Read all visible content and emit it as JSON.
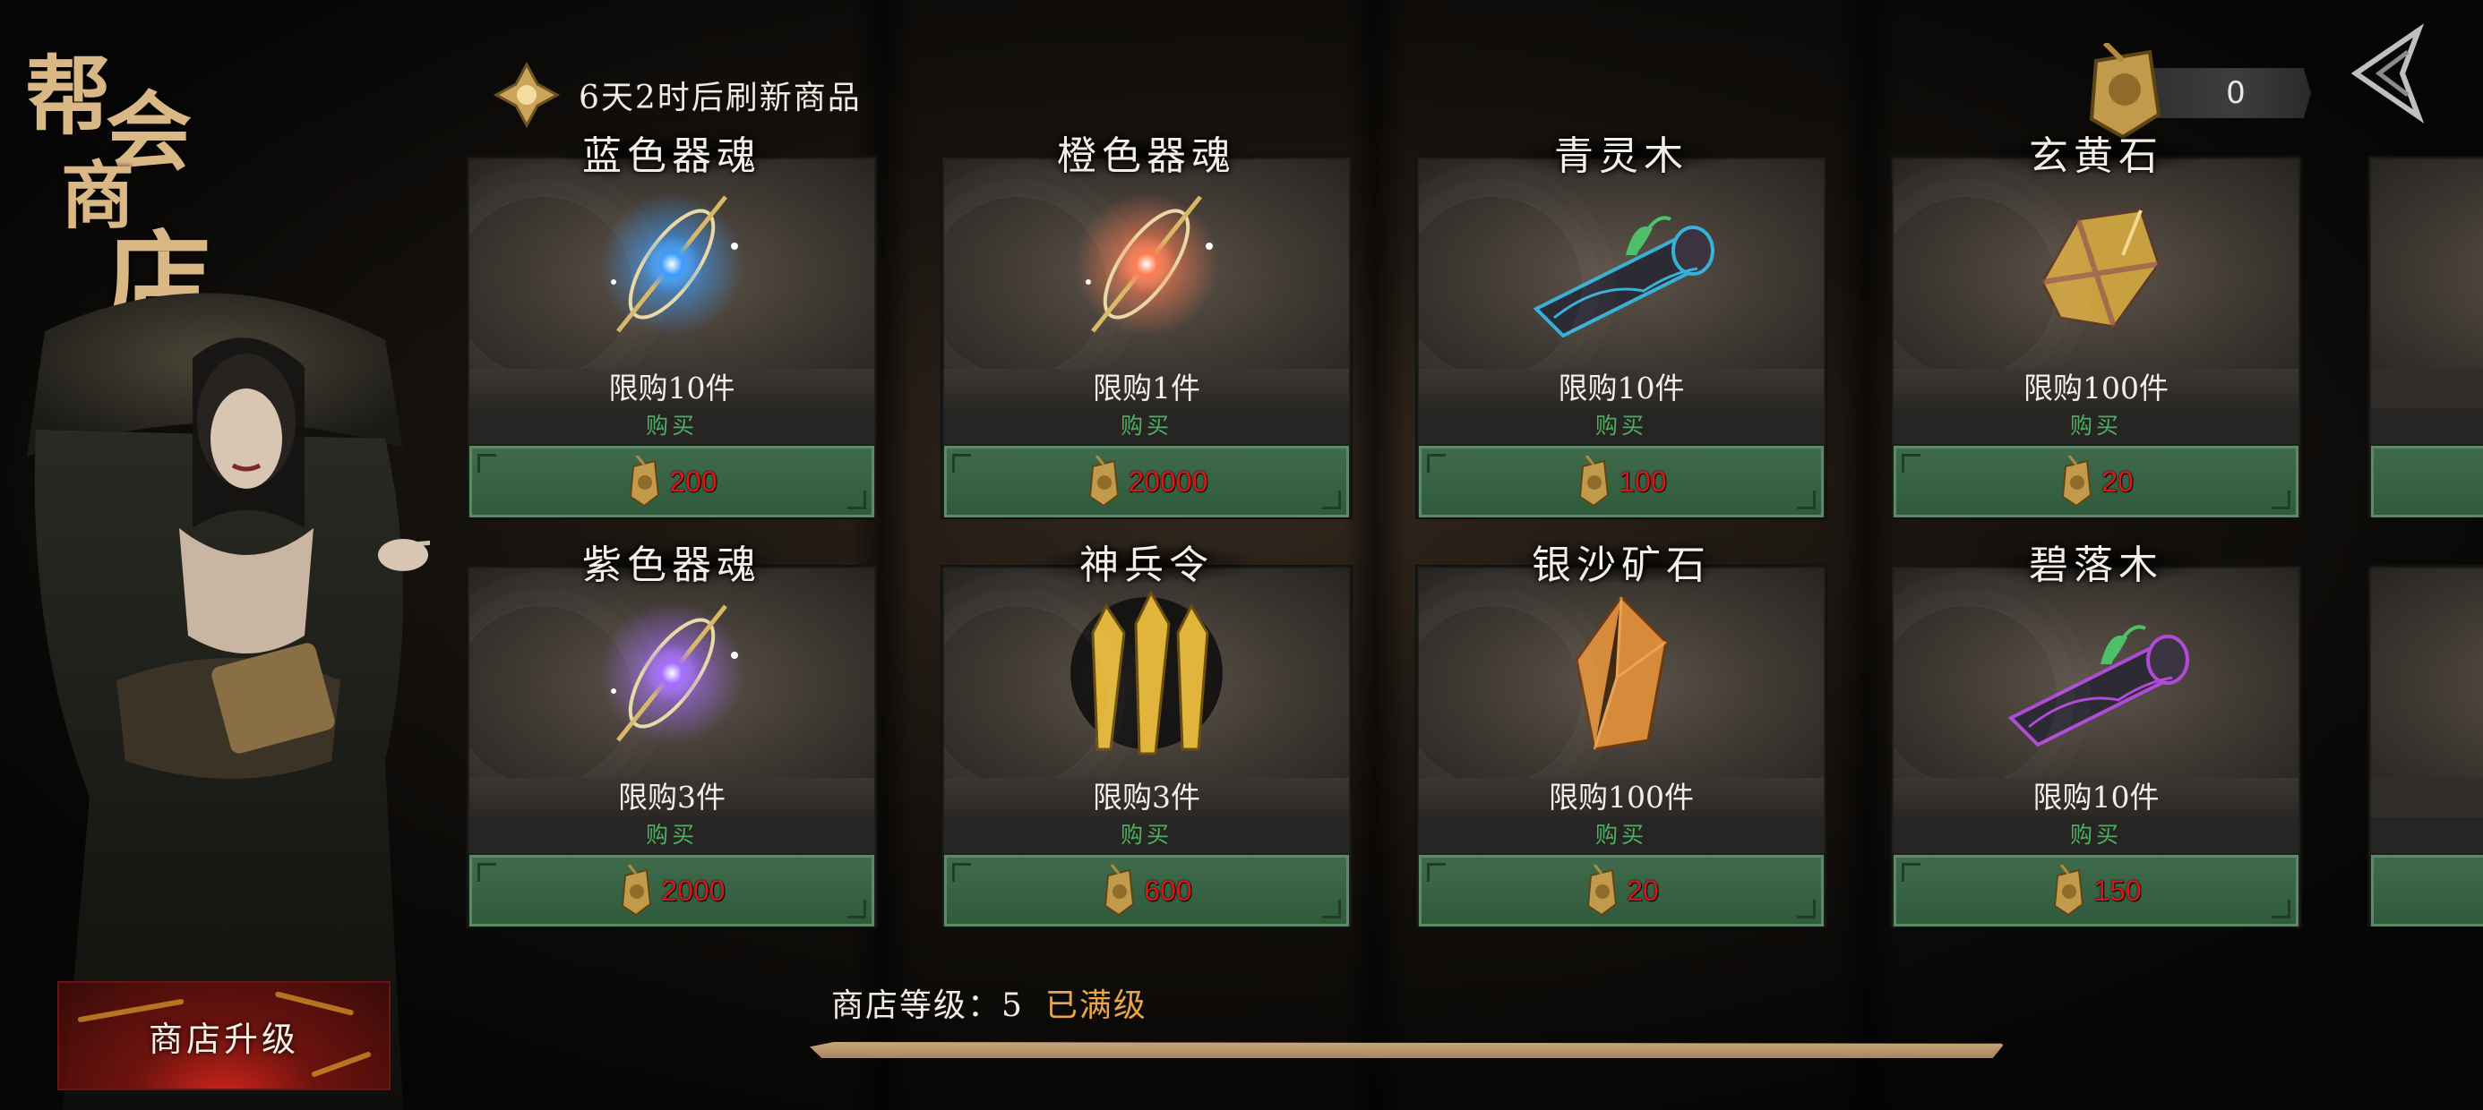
{
  "shop": {
    "title_chars": [
      "帮",
      "会",
      "商",
      "店"
    ]
  },
  "header": {
    "refresh_text": "6天2时后刷新商品",
    "currency_amount": "0"
  },
  "items": [
    {
      "name": "蓝色器魂",
      "limit": "限购10件",
      "buy_label": "购买",
      "price": "200",
      "icon": "blue-orb-icon",
      "color": "#3a9cff"
    },
    {
      "name": "橙色器魂",
      "limit": "限购1件",
      "buy_label": "购买",
      "price": "20000",
      "icon": "orange-orb-icon",
      "color": "#ff7a50"
    },
    {
      "name": "青灵木",
      "limit": "限购10件",
      "buy_label": "购买",
      "price": "100",
      "icon": "qingling-wood-icon",
      "color": "#38b0d8"
    },
    {
      "name": "玄黄石",
      "limit": "限购100件",
      "buy_label": "购买",
      "price": "20",
      "icon": "xuanhuang-stone-icon",
      "color": "#c9a040"
    },
    {
      "name": "紫色器魂",
      "limit": "限购3件",
      "buy_label": "购买",
      "price": "2000",
      "icon": "purple-orb-icon",
      "color": "#a26bff"
    },
    {
      "name": "神兵令",
      "limit": "限购3件",
      "buy_label": "购买",
      "price": "600",
      "icon": "divine-token-icon",
      "color": "#e1b53c"
    },
    {
      "name": "银沙矿石",
      "limit": "限购100件",
      "buy_label": "购买",
      "price": "20",
      "icon": "silver-ore-icon",
      "color": "#d68a3a"
    },
    {
      "name": "碧落木",
      "limit": "限购10件",
      "buy_label": "购买",
      "price": "150",
      "icon": "biluo-wood-icon",
      "color": "#b04ad8"
    }
  ],
  "footer": {
    "upgrade_label": "商店升级",
    "level_label": "商店等级：5",
    "level_status": "已满级"
  }
}
